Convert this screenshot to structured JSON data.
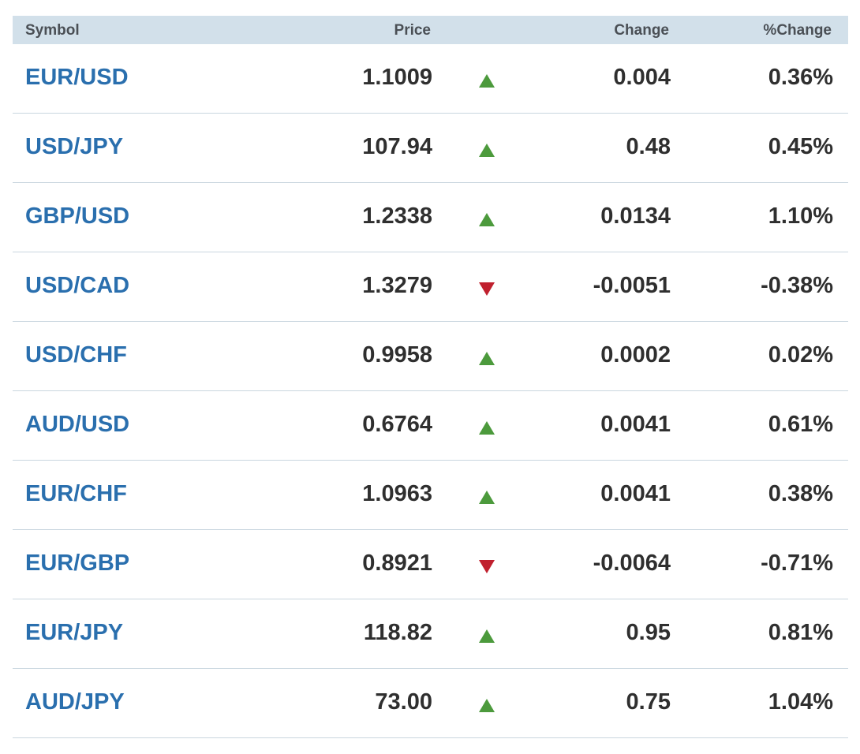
{
  "header": {
    "symbol": "Symbol",
    "price": "Price",
    "change": "Change",
    "pct_change": "%Change"
  },
  "colors": {
    "up": "#4c9a3c",
    "down": "#c0202e",
    "symbol_link": "#2a6fae",
    "header_bg": "#d2e0ea"
  },
  "rows": [
    {
      "symbol": "EUR/USD",
      "price": "1.1009",
      "direction": "up",
      "change": "0.004",
      "pct_change": "0.36%"
    },
    {
      "symbol": "USD/JPY",
      "price": "107.94",
      "direction": "up",
      "change": "0.48",
      "pct_change": "0.45%"
    },
    {
      "symbol": "GBP/USD",
      "price": "1.2338",
      "direction": "up",
      "change": "0.0134",
      "pct_change": "1.10%"
    },
    {
      "symbol": "USD/CAD",
      "price": "1.3279",
      "direction": "down",
      "change": "-0.0051",
      "pct_change": "-0.38%"
    },
    {
      "symbol": "USD/CHF",
      "price": "0.9958",
      "direction": "up",
      "change": "0.0002",
      "pct_change": "0.02%"
    },
    {
      "symbol": "AUD/USD",
      "price": "0.6764",
      "direction": "up",
      "change": "0.0041",
      "pct_change": "0.61%"
    },
    {
      "symbol": "EUR/CHF",
      "price": "1.0963",
      "direction": "up",
      "change": "0.0041",
      "pct_change": "0.38%"
    },
    {
      "symbol": "EUR/GBP",
      "price": "0.8921",
      "direction": "down",
      "change": "-0.0064",
      "pct_change": "-0.71%"
    },
    {
      "symbol": "EUR/JPY",
      "price": "118.82",
      "direction": "up",
      "change": "0.95",
      "pct_change": "0.81%"
    },
    {
      "symbol": "AUD/JPY",
      "price": "73.00",
      "direction": "up",
      "change": "0.75",
      "pct_change": "1.04%"
    }
  ]
}
